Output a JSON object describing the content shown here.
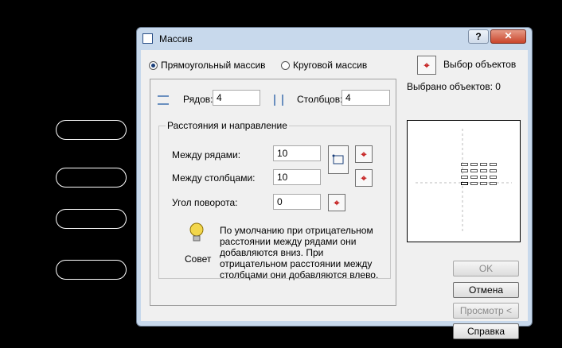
{
  "dialog": {
    "title": "Массив",
    "help_button": "?",
    "close_button": "✕"
  },
  "mode": {
    "rect_label": "Прямоугольный массив",
    "polar_label": "Круговой массив",
    "selected": "rect"
  },
  "selection": {
    "button_label": "Выбор объектов",
    "count_label": "Выбрано объектов: 0"
  },
  "grid": {
    "rows_label": "Рядов:",
    "rows_value": "4",
    "cols_label": "Столбцов:",
    "cols_value": "4"
  },
  "offsets": {
    "group_title": "Расстояния и направление",
    "row_spacing_label": "Между рядами:",
    "row_spacing_value": "10",
    "col_spacing_label": "Между столбцами:",
    "col_spacing_value": "10",
    "angle_label": "Угол поворота:",
    "angle_value": "0"
  },
  "tip": {
    "label": "Совет",
    "text": "По умолчанию при отрицательном расстоянии между рядами они добавляются вниз. При отрицательном расстоянии между столбцами они добавляются влево."
  },
  "buttons": {
    "ok": "OK",
    "cancel": "Отмена",
    "preview": "Просмотр <",
    "help": "Справка"
  },
  "colors": {
    "dialog_frame": "#c8d9ec",
    "close_button": "#c9452c",
    "pick_cursor": "#c41a1a"
  }
}
